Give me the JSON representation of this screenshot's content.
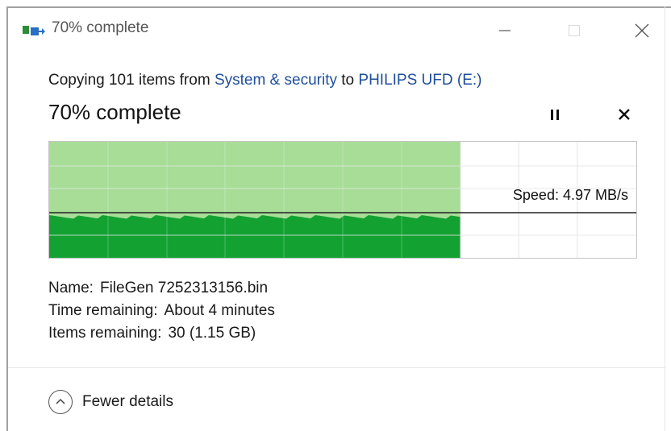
{
  "window": {
    "title": "70% complete",
    "controls": {
      "minimize": "minimize",
      "maximize": "maximize",
      "close": "close"
    }
  },
  "copy": {
    "prefix": "Copying 101 items from",
    "source": "System & security",
    "connector": "to",
    "destination": "PHILIPS UFD (E:)",
    "heading": "70% complete",
    "progress_fraction": 0.7
  },
  "graph": {
    "speed_text": "Speed: 4.97 MB/s",
    "colors": {
      "total": "#a7dd97",
      "speed": "#13a232",
      "line": "#222222",
      "grid": "#e4e4e4"
    }
  },
  "details": {
    "name_label": "Name:",
    "name_value": "FileGen 7252313156.bin",
    "time_label": "Time remaining:",
    "time_value": "About 4 minutes",
    "items_label": "Items remaining:",
    "items_value": "30 (1.15 GB)"
  },
  "footer": {
    "toggle_label": "Fewer details"
  },
  "icons": {
    "app": "file-copy-icon",
    "pause": "pause-icon",
    "cancel": "close-icon",
    "toggle": "chevron-up-icon"
  }
}
